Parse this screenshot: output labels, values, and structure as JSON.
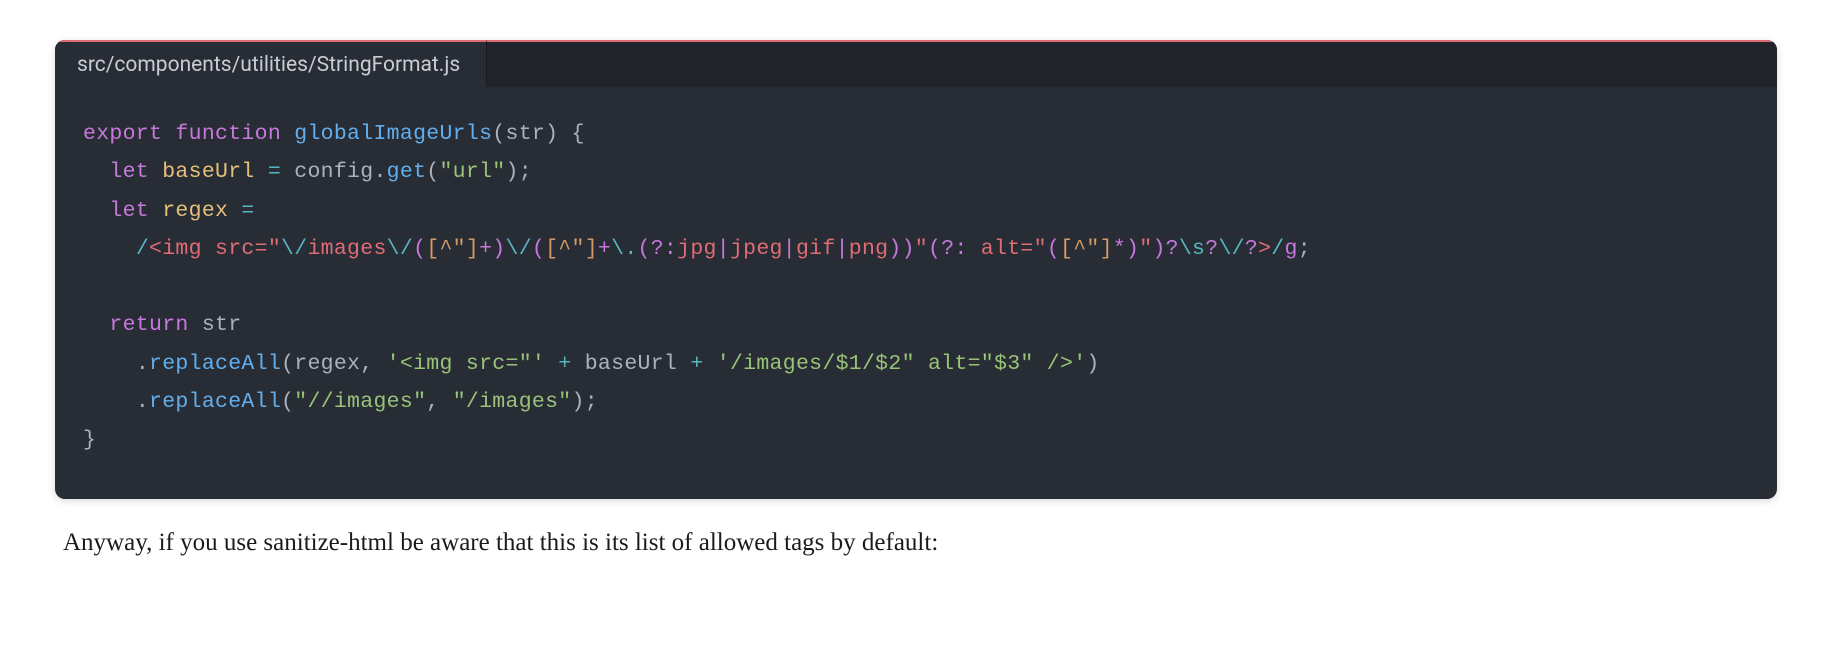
{
  "tab": {
    "title": "src/components/utilities/StringFormat.js"
  },
  "code": {
    "l1": {
      "export": "export",
      "function": "function",
      "name": "globalImageUrls",
      "paren_open": "(",
      "param": "str",
      "paren_close": ")",
      "brace": " {"
    },
    "l2": {
      "indent": "  ",
      "let": "let",
      "var": "baseUrl",
      "eq": " = ",
      "obj": "config",
      "dot": ".",
      "method": "get",
      "po": "(",
      "str": "\"url\"",
      "pc": ")",
      "semi": ";"
    },
    "l3": {
      "indent": "  ",
      "let": "let",
      "var": "regex",
      "eq": " ="
    },
    "l4": {
      "indent": "    ",
      "s1": "/",
      "r1": "<img src=\"",
      "e1": "\\/",
      "r2": "images",
      "e2": "\\/",
      "po1": "(",
      "cls1": "[^\"]",
      "q1": "+",
      "pc1": ")",
      "e3": "\\/",
      "po2": "(",
      "cls2": "[^\"]",
      "q2": "+",
      "e4": "\\.",
      "po3": "(?:",
      "alt1": "jpg",
      "pipe1": "|",
      "alt2": "jpeg",
      "pipe2": "|",
      "alt3": "gif",
      "pipe3": "|",
      "alt4": "png",
      "pc3": ")",
      "pc2": ")",
      "r3": "\"",
      "po4": "(?:",
      "r4": " alt=\"",
      "po5": "(",
      "cls3": "[^\"]",
      "q3": "*",
      "pc5": ")",
      "r5": "\"",
      "pc4": ")",
      "q4": "?",
      "e5": "\\s",
      "q5": "?",
      "e6": "\\/",
      "q6": "?",
      "r6": ">",
      "s2": "/",
      "flg": "g",
      "semi": ";"
    },
    "l6": {
      "indent": "  ",
      "return": "return",
      "var": "str"
    },
    "l7": {
      "indent": "    ",
      "dot": ".",
      "method": "replaceAll",
      "po": "(",
      "arg1": "regex",
      "comma": ", ",
      "s1": "'<img src=\"'",
      "plus1": " + ",
      "arg2": "baseUrl",
      "plus2": " + ",
      "s2": "'/images/$1/$2\" alt=\"$3\" />'",
      "pc": ")"
    },
    "l8": {
      "indent": "    ",
      "dot": ".",
      "method": "replaceAll",
      "po": "(",
      "s1": "\"//images\"",
      "comma": ", ",
      "s2": "\"/images\"",
      "pc": ")",
      "semi": ";"
    },
    "l9": {
      "brace": "}"
    }
  },
  "body_text": "Anyway, if you use sanitize-html be aware that this is its list of allowed tags by default:"
}
